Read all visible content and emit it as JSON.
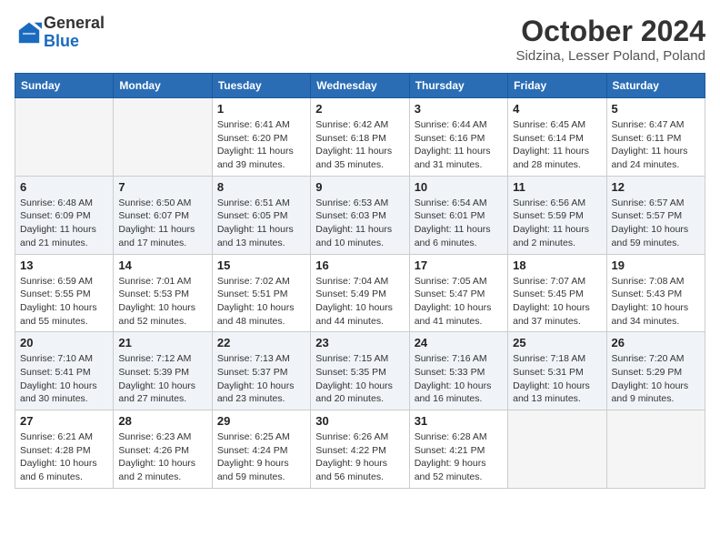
{
  "header": {
    "logo_general": "General",
    "logo_blue": "Blue",
    "month_title": "October 2024",
    "location": "Sidzina, Lesser Poland, Poland"
  },
  "days_of_week": [
    "Sunday",
    "Monday",
    "Tuesday",
    "Wednesday",
    "Thursday",
    "Friday",
    "Saturday"
  ],
  "weeks": [
    [
      {
        "date": "",
        "info": ""
      },
      {
        "date": "",
        "info": ""
      },
      {
        "date": "1",
        "info": "Sunrise: 6:41 AM\nSunset: 6:20 PM\nDaylight: 11 hours and 39 minutes."
      },
      {
        "date": "2",
        "info": "Sunrise: 6:42 AM\nSunset: 6:18 PM\nDaylight: 11 hours and 35 minutes."
      },
      {
        "date": "3",
        "info": "Sunrise: 6:44 AM\nSunset: 6:16 PM\nDaylight: 11 hours and 31 minutes."
      },
      {
        "date": "4",
        "info": "Sunrise: 6:45 AM\nSunset: 6:14 PM\nDaylight: 11 hours and 28 minutes."
      },
      {
        "date": "5",
        "info": "Sunrise: 6:47 AM\nSunset: 6:11 PM\nDaylight: 11 hours and 24 minutes."
      }
    ],
    [
      {
        "date": "6",
        "info": "Sunrise: 6:48 AM\nSunset: 6:09 PM\nDaylight: 11 hours and 21 minutes."
      },
      {
        "date": "7",
        "info": "Sunrise: 6:50 AM\nSunset: 6:07 PM\nDaylight: 11 hours and 17 minutes."
      },
      {
        "date": "8",
        "info": "Sunrise: 6:51 AM\nSunset: 6:05 PM\nDaylight: 11 hours and 13 minutes."
      },
      {
        "date": "9",
        "info": "Sunrise: 6:53 AM\nSunset: 6:03 PM\nDaylight: 11 hours and 10 minutes."
      },
      {
        "date": "10",
        "info": "Sunrise: 6:54 AM\nSunset: 6:01 PM\nDaylight: 11 hours and 6 minutes."
      },
      {
        "date": "11",
        "info": "Sunrise: 6:56 AM\nSunset: 5:59 PM\nDaylight: 11 hours and 2 minutes."
      },
      {
        "date": "12",
        "info": "Sunrise: 6:57 AM\nSunset: 5:57 PM\nDaylight: 10 hours and 59 minutes."
      }
    ],
    [
      {
        "date": "13",
        "info": "Sunrise: 6:59 AM\nSunset: 5:55 PM\nDaylight: 10 hours and 55 minutes."
      },
      {
        "date": "14",
        "info": "Sunrise: 7:01 AM\nSunset: 5:53 PM\nDaylight: 10 hours and 52 minutes."
      },
      {
        "date": "15",
        "info": "Sunrise: 7:02 AM\nSunset: 5:51 PM\nDaylight: 10 hours and 48 minutes."
      },
      {
        "date": "16",
        "info": "Sunrise: 7:04 AM\nSunset: 5:49 PM\nDaylight: 10 hours and 44 minutes."
      },
      {
        "date": "17",
        "info": "Sunrise: 7:05 AM\nSunset: 5:47 PM\nDaylight: 10 hours and 41 minutes."
      },
      {
        "date": "18",
        "info": "Sunrise: 7:07 AM\nSunset: 5:45 PM\nDaylight: 10 hours and 37 minutes."
      },
      {
        "date": "19",
        "info": "Sunrise: 7:08 AM\nSunset: 5:43 PM\nDaylight: 10 hours and 34 minutes."
      }
    ],
    [
      {
        "date": "20",
        "info": "Sunrise: 7:10 AM\nSunset: 5:41 PM\nDaylight: 10 hours and 30 minutes."
      },
      {
        "date": "21",
        "info": "Sunrise: 7:12 AM\nSunset: 5:39 PM\nDaylight: 10 hours and 27 minutes."
      },
      {
        "date": "22",
        "info": "Sunrise: 7:13 AM\nSunset: 5:37 PM\nDaylight: 10 hours and 23 minutes."
      },
      {
        "date": "23",
        "info": "Sunrise: 7:15 AM\nSunset: 5:35 PM\nDaylight: 10 hours and 20 minutes."
      },
      {
        "date": "24",
        "info": "Sunrise: 7:16 AM\nSunset: 5:33 PM\nDaylight: 10 hours and 16 minutes."
      },
      {
        "date": "25",
        "info": "Sunrise: 7:18 AM\nSunset: 5:31 PM\nDaylight: 10 hours and 13 minutes."
      },
      {
        "date": "26",
        "info": "Sunrise: 7:20 AM\nSunset: 5:29 PM\nDaylight: 10 hours and 9 minutes."
      }
    ],
    [
      {
        "date": "27",
        "info": "Sunrise: 6:21 AM\nSunset: 4:28 PM\nDaylight: 10 hours and 6 minutes."
      },
      {
        "date": "28",
        "info": "Sunrise: 6:23 AM\nSunset: 4:26 PM\nDaylight: 10 hours and 2 minutes."
      },
      {
        "date": "29",
        "info": "Sunrise: 6:25 AM\nSunset: 4:24 PM\nDaylight: 9 hours and 59 minutes."
      },
      {
        "date": "30",
        "info": "Sunrise: 6:26 AM\nSunset: 4:22 PM\nDaylight: 9 hours and 56 minutes."
      },
      {
        "date": "31",
        "info": "Sunrise: 6:28 AM\nSunset: 4:21 PM\nDaylight: 9 hours and 52 minutes."
      },
      {
        "date": "",
        "info": ""
      },
      {
        "date": "",
        "info": ""
      }
    ]
  ]
}
